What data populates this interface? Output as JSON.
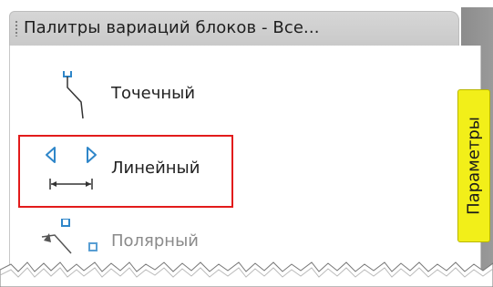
{
  "window": {
    "title": "Палитры вариаций блоков - Все..."
  },
  "side_tab": {
    "label": "Параметры"
  },
  "items": [
    {
      "label": "Точечный",
      "icon": "point-parameter-icon",
      "selected": false
    },
    {
      "label": "Линейный",
      "icon": "linear-parameter-icon",
      "selected": true
    },
    {
      "label": "Полярный",
      "icon": "polar-parameter-icon",
      "selected": false
    }
  ],
  "colors": {
    "selection_border": "#e21b1b",
    "tab_background": "#f2ef19",
    "icon_blue": "#2f86c9"
  }
}
